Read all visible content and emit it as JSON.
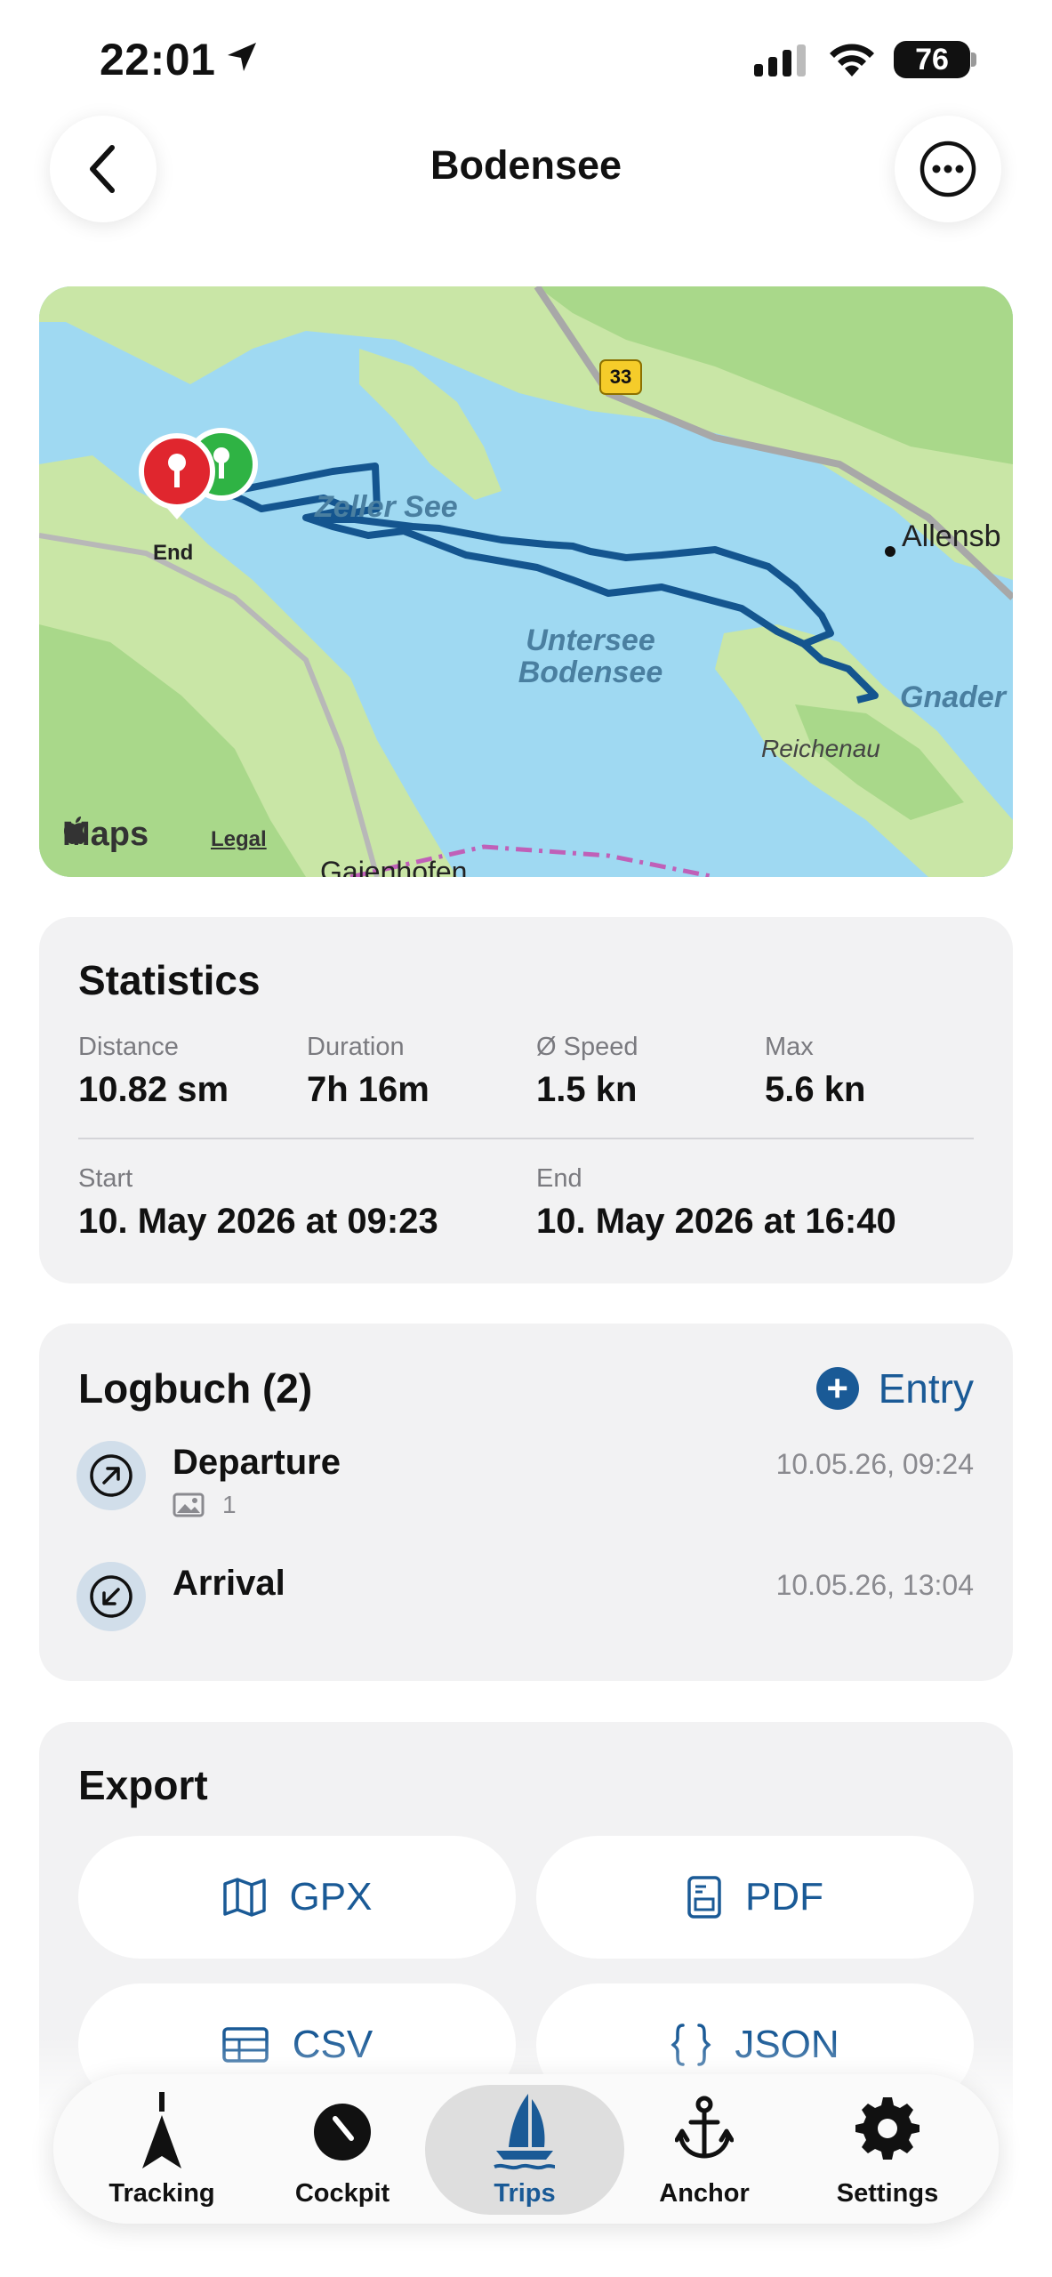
{
  "status": {
    "time": "22:01",
    "battery": "76"
  },
  "nav": {
    "title": "Bodensee"
  },
  "map": {
    "labels": {
      "zeller_see": "Zeller See",
      "untersee": "Untersee Bodensee",
      "end_marker": "End",
      "allensbach": "Allensb",
      "gnaden": "Gnader",
      "reichenau": "Reichenau",
      "gaienhofen": "Gaienhofen",
      "road": "33"
    },
    "maps_brand": "Maps",
    "legal": "Legal"
  },
  "statistics": {
    "title": "Statistics",
    "distance": {
      "label": "Distance",
      "value": "10.82 sm"
    },
    "duration": {
      "label": "Duration",
      "value": "7h 16m"
    },
    "speed": {
      "label": "Ø Speed",
      "value": "1.5 kn"
    },
    "max": {
      "label": "Max",
      "value": "5.6 kn"
    },
    "start": {
      "label": "Start",
      "value": "10. May 2026 at 09:23"
    },
    "end": {
      "label": "End",
      "value": "10. May 2026 at 16:40"
    }
  },
  "logbook": {
    "title": "Logbuch (2)",
    "entry_label": "Entry",
    "entries": [
      {
        "title": "Departure",
        "time": "10.05.26, 09:24",
        "photos": "1"
      },
      {
        "title": "Arrival",
        "time": "10.05.26, 13:04"
      }
    ]
  },
  "export": {
    "title": "Export",
    "buttons": {
      "gpx": "GPX",
      "pdf": "PDF",
      "csv": "CSV",
      "json": "JSON"
    }
  },
  "tabs": [
    {
      "label": "Tracking"
    },
    {
      "label": "Cockpit"
    },
    {
      "label": "Trips",
      "active": true
    },
    {
      "label": "Anchor"
    },
    {
      "label": "Settings"
    }
  ],
  "colors": {
    "accent": "#1a5a96",
    "track": "#14558f",
    "water": "#9fd9f2",
    "land": "#c9e6a6"
  }
}
